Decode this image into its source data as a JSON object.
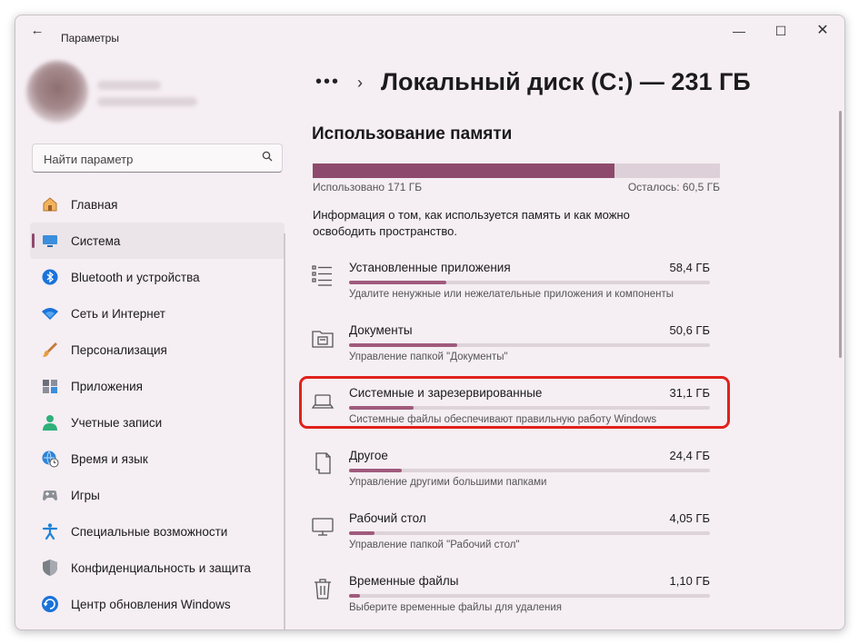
{
  "window": {
    "back_label": "←",
    "title": "Параметры",
    "minimize": "—",
    "maximize": "☐",
    "close": "✕"
  },
  "search": {
    "placeholder": "Найти параметр"
  },
  "sidebar": {
    "items": [
      {
        "label": "Главная",
        "icon": "home-icon",
        "active": false
      },
      {
        "label": "Система",
        "icon": "system-icon",
        "active": true
      },
      {
        "label": "Bluetooth и устройства",
        "icon": "bluetooth-icon",
        "active": false
      },
      {
        "label": "Сеть и Интернет",
        "icon": "wifi-icon",
        "active": false
      },
      {
        "label": "Персонализация",
        "icon": "brush-icon",
        "active": false
      },
      {
        "label": "Приложения",
        "icon": "apps-icon",
        "active": false
      },
      {
        "label": "Учетные записи",
        "icon": "account-icon",
        "active": false
      },
      {
        "label": "Время и язык",
        "icon": "time-language-icon",
        "active": false
      },
      {
        "label": "Игры",
        "icon": "gamepad-icon",
        "active": false
      },
      {
        "label": "Специальные возможности",
        "icon": "accessibility-icon",
        "active": false
      },
      {
        "label": "Конфиденциальность и защита",
        "icon": "shield-icon",
        "active": false
      },
      {
        "label": "Центр обновления Windows",
        "icon": "update-icon",
        "active": false
      }
    ]
  },
  "breadcrumb": {
    "more": "•••",
    "separator": "›",
    "title": "Локальный диск (C:) — 231 ГБ"
  },
  "storage": {
    "section_title": "Использование памяти",
    "used_label": "Использовано 171 ГБ",
    "free_label": "Осталось: 60,5 ГБ",
    "used_fraction": 0.74,
    "info": "Информация о том, как используется память и как можно освободить пространство."
  },
  "categories": [
    {
      "name": "Установленные приложения",
      "size": "58,4 ГБ",
      "desc": "Удалите ненужные или нежелательные приложения и компоненты",
      "fraction": 0.27,
      "icon": "apps-list-icon"
    },
    {
      "name": "Документы",
      "size": "50,6 ГБ",
      "desc": "Управление папкой \"Документы\"",
      "fraction": 0.3,
      "icon": "documents-folder-icon"
    },
    {
      "name": "Системные и зарезервированные",
      "size": "31,1 ГБ",
      "desc": "Системные файлы обеспечивают правильную работу Windows",
      "fraction": 0.18,
      "icon": "laptop-icon"
    },
    {
      "name": "Другое",
      "size": "24,4 ГБ",
      "desc": "Управление другими большими папками",
      "fraction": 0.145,
      "icon": "other-file-icon"
    },
    {
      "name": "Рабочий стол",
      "size": "4,05 ГБ",
      "desc": "Управление папкой \"Рабочий стол\"",
      "fraction": 0.07,
      "icon": "desktop-icon"
    },
    {
      "name": "Временные файлы",
      "size": "1,10 ГБ",
      "desc": "Выберите временные файлы для удаления",
      "fraction": 0.03,
      "icon": "trash-icon"
    }
  ],
  "colors": {
    "accent": "#8e4a6c",
    "bar_fill": "#a05a7c",
    "highlight": "#e0221b"
  }
}
